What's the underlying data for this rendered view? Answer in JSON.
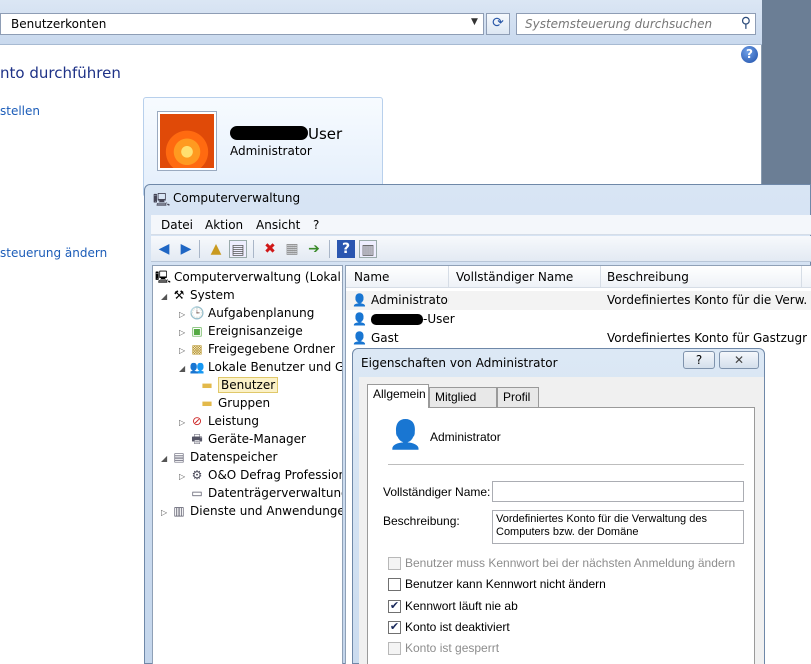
{
  "control_panel": {
    "address": "Benutzerkonten",
    "search_placeholder": "Systemsteuerung durchsuchen",
    "heading": "nto durchführen",
    "link_create": "stellen",
    "link_control": "steuerung ändern",
    "user_name_suffix": "User",
    "user_role": "Administrator"
  },
  "computer_management": {
    "title": "Computerverwaltung",
    "menu": [
      "Datei",
      "Aktion",
      "Ansicht",
      "?"
    ],
    "tree": [
      {
        "label": "Computerverwaltung (Lokal)",
        "icon": "computer-management-icon"
      },
      {
        "label": "System",
        "icon": "tools-icon"
      },
      {
        "label": "Aufgabenplanung",
        "icon": "clock-icon"
      },
      {
        "label": "Ereignisanzeige",
        "icon": "event-viewer-icon"
      },
      {
        "label": "Freigegebene Ordner",
        "icon": "shared-folder-icon"
      },
      {
        "label": "Lokale Benutzer und Gr",
        "icon": "users-icon"
      },
      {
        "label": "Benutzer",
        "icon": "folder-icon"
      },
      {
        "label": "Gruppen",
        "icon": "folder-icon"
      },
      {
        "label": "Leistung",
        "icon": "performance-icon"
      },
      {
        "label": "Geräte-Manager",
        "icon": "device-manager-icon"
      },
      {
        "label": "Datenspeicher",
        "icon": "storage-icon"
      },
      {
        "label": "O&O Defrag Profession",
        "icon": "defrag-icon"
      },
      {
        "label": "Datenträgerverwaltung",
        "icon": "disk-icon"
      },
      {
        "label": "Dienste und Anwendungen",
        "icon": "services-icon"
      }
    ],
    "columns": [
      "Name",
      "Vollständiger Name",
      "Beschreibung"
    ],
    "rows": [
      {
        "name": "Administrator",
        "fullname": "",
        "desc": "Vordefiniertes Konto für die Verw..."
      },
      {
        "name": "-User",
        "fullname": "",
        "desc": ""
      },
      {
        "name": "Gast",
        "fullname": "",
        "desc": "Vordefiniertes Konto für Gastzugri..."
      }
    ]
  },
  "properties_dialog": {
    "title": "Eigenschaften von Administrator",
    "help_label": "?",
    "tabs": [
      "Allgemein",
      "Mitglied von",
      "Profil"
    ],
    "account_name": "Administrator",
    "fullname_label": "Vollständiger Name:",
    "fullname_value": "",
    "description_label": "Beschreibung:",
    "description_value": "Vordefiniertes Konto für die Verwaltung des Computers bzw. der Domäne",
    "checkboxes": [
      {
        "label": "Benutzer muss Kennwort bei der nächsten Anmeldung ändern",
        "checked": false,
        "enabled": false
      },
      {
        "label": "Benutzer kann Kennwort nicht ändern",
        "checked": false,
        "enabled": true
      },
      {
        "label": "Kennwort läuft nie ab",
        "checked": true,
        "enabled": true
      },
      {
        "label": "Konto ist deaktiviert",
        "checked": true,
        "enabled": true
      },
      {
        "label": "Konto ist gesperrt",
        "checked": false,
        "enabled": false
      }
    ]
  }
}
